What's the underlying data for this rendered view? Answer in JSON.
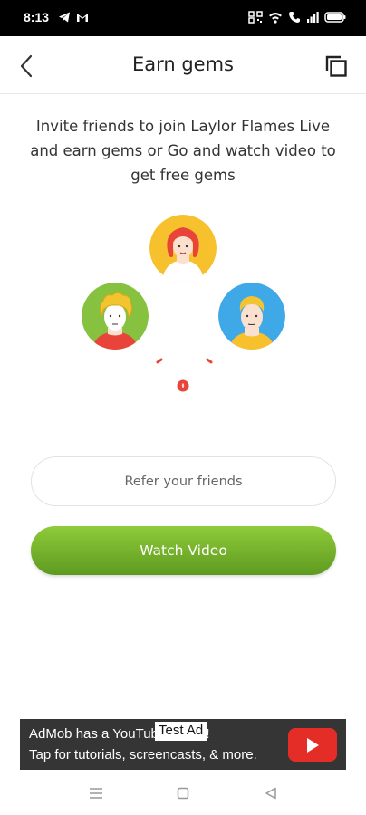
{
  "status_bar": {
    "time": "8:13",
    "left_icons": [
      "telegram-icon",
      "gmail-icon"
    ],
    "right_icons": [
      "qr-icon",
      "wifi-icon",
      "call-icon",
      "signal-icon",
      "battery-icon"
    ],
    "battery_level": "88"
  },
  "header": {
    "title": "Earn gems",
    "back_icon": "chevron-left-icon",
    "copy_icon": "copy-icon"
  },
  "intro_text": "Invite friends to join Laylor Flames Live and earn gems or Go and watch video to get free gems",
  "avatars": {
    "top": {
      "bg_color": "#f7c12d",
      "hair_color": "#e8443a"
    },
    "left": {
      "bg_color": "#86c240",
      "hair_color": "#f2c42f"
    },
    "right": {
      "bg_color": "#3fa8e6",
      "hair_color": "#f2c42f"
    }
  },
  "buttons": {
    "refer_label": "Refer your friends",
    "watch_label": "Watch Video"
  },
  "ad": {
    "line1": "AdMob has a YouTube series!",
    "line2": "Tap for tutorials, screencasts, & more.",
    "test_badge": "Test Ad"
  },
  "colors": {
    "accent_green": "#6fae28",
    "accent_red": "#e8443a",
    "youtube_red": "#e52d27"
  }
}
